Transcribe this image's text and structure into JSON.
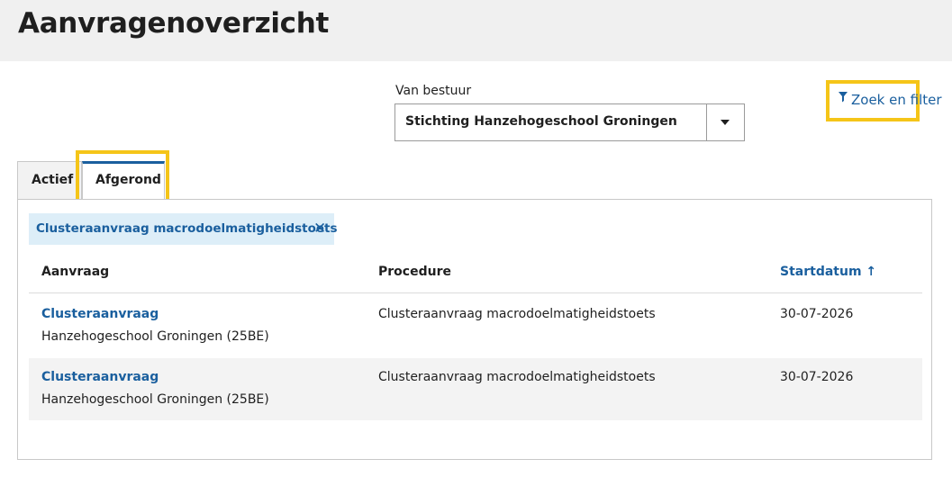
{
  "page": {
    "title": "Aanvragenoverzicht"
  },
  "bestuur": {
    "label": "Van bestuur",
    "selected": "Stichting Hanzehogeschool Groningen"
  },
  "filter": {
    "icon": "funnel-icon",
    "label": "Zoek en filter"
  },
  "tabs": [
    {
      "label": "Actief",
      "active": false
    },
    {
      "label": "Afgerond",
      "active": true
    }
  ],
  "active_filter_chip": {
    "label": "Clusteraanvraag macrodoelmatigheidstoets",
    "close_icon": "close-icon"
  },
  "table": {
    "columns": [
      "Aanvraag",
      "Procedure",
      "Startdatum"
    ],
    "sort_indicator": "↑",
    "rows": [
      {
        "title": "Clusteraanvraag",
        "subtitle": "Hanzehogeschool Groningen (25BE)",
        "procedure": "Clusteraanvraag macrodoelmatigheidstoets",
        "startdatum": "30-07-2026"
      },
      {
        "title": "Clusteraanvraag",
        "subtitle": "Hanzehogeschool Groningen (25BE)",
        "procedure": "Clusteraanvraag macrodoelmatigheidstoets",
        "startdatum": "30-07-2026"
      }
    ]
  },
  "colors": {
    "accent": "#1a5f9e",
    "highlight": "#f5c518",
    "chip_bg": "#ddeef8",
    "header_bg": "#f0f0f0"
  }
}
